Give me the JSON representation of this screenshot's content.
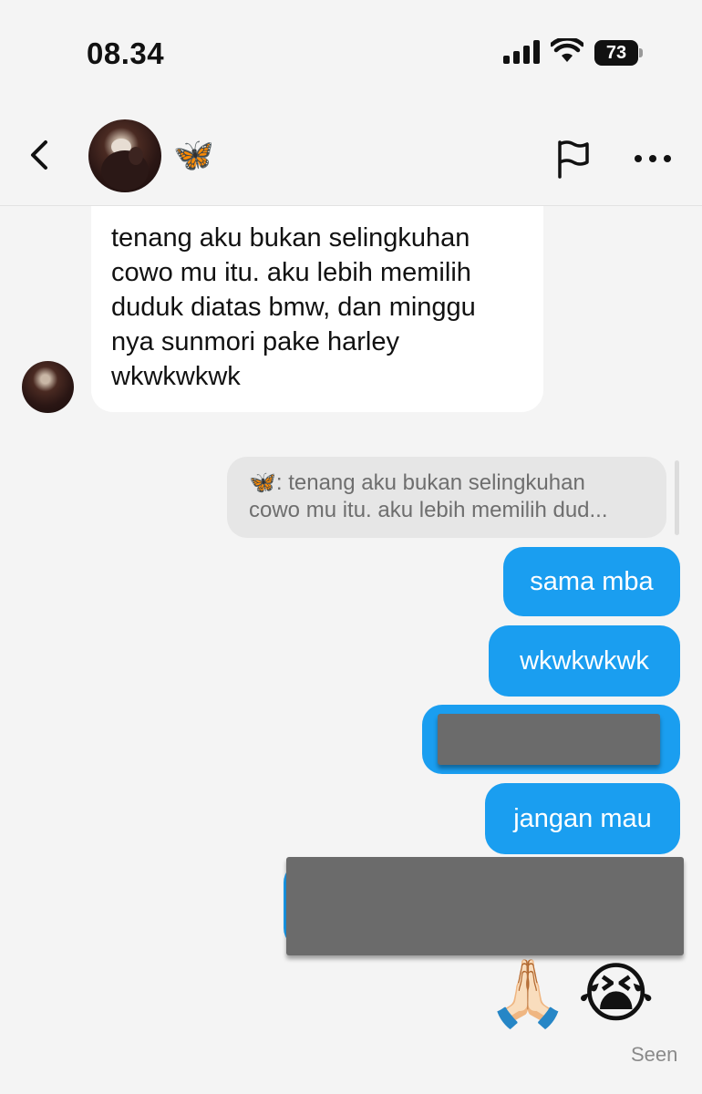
{
  "status_bar": {
    "time": "08.34",
    "battery_level": "73"
  },
  "header": {
    "contact_name": "🦋",
    "icons": [
      "back-arrow-icon",
      "flag-icon",
      "more-horizontal-icon"
    ]
  },
  "messages": {
    "received_text": "tenang aku bukan selingkuhan\ncowo mu itu. aku lebih memilih\nduduk diatas bmw, dan minggu\nnya sunmori pake harley\nwkwkwkwk",
    "reply_quote": "🦋: tenang aku bukan selingkuhan\ncowo mu itu. aku lebih memilih dud...",
    "sent_1": "sama mba",
    "sent_2": "wkwkwkwk",
    "sent_4": "jangan mau",
    "emoji_1": "🙏🏻",
    "emoji_2": "😭",
    "seen": "Seen"
  },
  "colors": {
    "sent_bubble": "#1a9ef0",
    "received_bubble": "#ffffff",
    "background": "#f4f4f4",
    "redaction": "#6b6b6b"
  }
}
